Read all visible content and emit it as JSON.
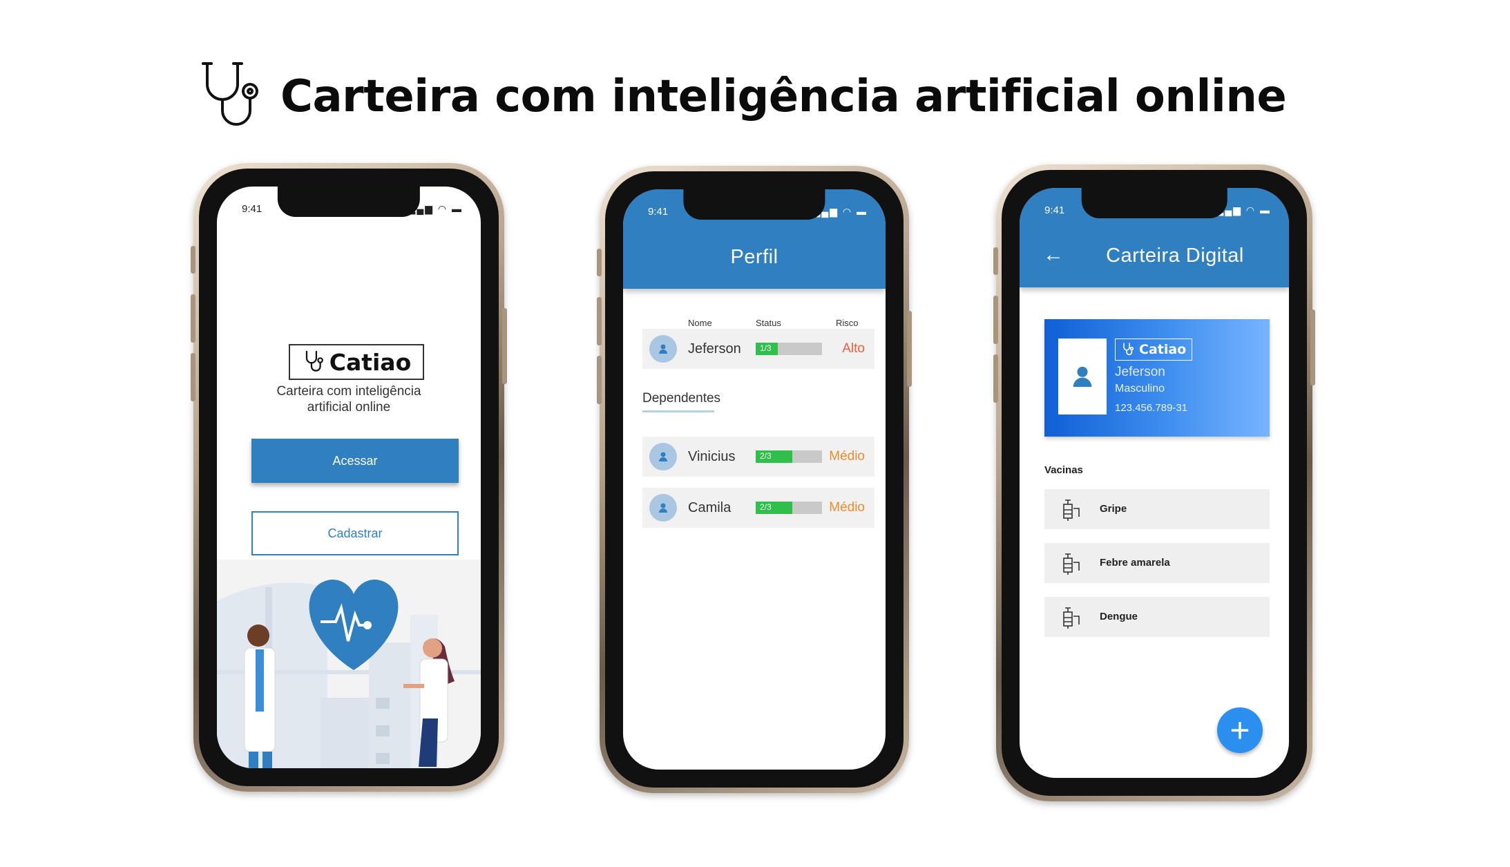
{
  "header": {
    "title": "Carteira com inteligência artificial online",
    "icon": "stethoscope-icon"
  },
  "status": {
    "time": "9:41",
    "icons": "signal wifi battery"
  },
  "login_screen": {
    "brand": "Catiao",
    "tagline_line1": "Carteira com inteligência",
    "tagline_line2": "artificial online",
    "login_button": "Acessar",
    "signup_button": "Cadastrar"
  },
  "profile_screen": {
    "title": "Perfil",
    "columns": {
      "name": "Nome",
      "status": "Status",
      "risk": "Risco"
    },
    "main_person": {
      "name": "Jeferson",
      "status": "1/3",
      "progress": 0.333,
      "risk": "Alto"
    },
    "dependents_label": "Dependentes",
    "dependents": [
      {
        "name": "Vinicius",
        "status": "2/3",
        "progress": 0.55,
        "risk": "Médio"
      },
      {
        "name": "Camila",
        "status": "2/3",
        "progress": 0.55,
        "risk": "Médio"
      }
    ]
  },
  "card_screen": {
    "title": "Carteira Digital",
    "card": {
      "brand": "Catiao",
      "name": "Jeferson",
      "sex": "Masculino",
      "document": "123.456.789-31"
    },
    "vaccines_label": "Vacinas",
    "vaccines": [
      {
        "name": "Gripe"
      },
      {
        "name": "Febre amarela"
      },
      {
        "name": "Dengue"
      }
    ],
    "fab_label": "+"
  },
  "colors": {
    "primary": "#2f7fc1",
    "risk_high": "#f25a3c",
    "risk_medium": "#f08a2c",
    "progress": "#2fbf4a"
  }
}
